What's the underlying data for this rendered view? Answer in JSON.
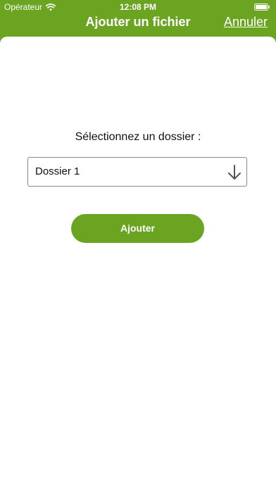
{
  "status_bar": {
    "carrier": "Opérateur",
    "time": "12:08 PM",
    "icons": [
      "wifi-icon",
      "battery-icon"
    ]
  },
  "nav": {
    "title": "Ajouter un fichier",
    "cancel_label": "Annuler"
  },
  "form": {
    "prompt": "Sélectionnez un dossier :",
    "folder_select": {
      "selected": "Dossier 1",
      "icon": "arrow-down-icon"
    },
    "submit_label": "Ajouter"
  },
  "colors": {
    "accent": "#6aa421",
    "background": "#ffffff",
    "text": "#111111"
  }
}
